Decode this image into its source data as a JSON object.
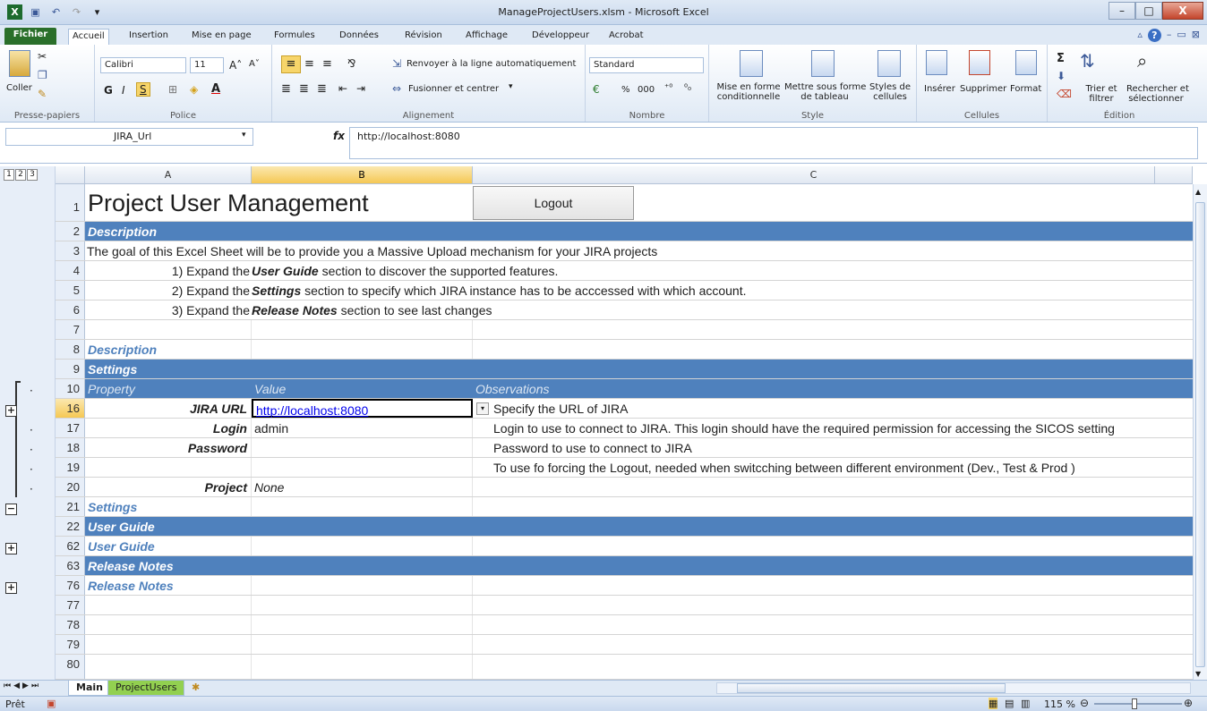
{
  "window": {
    "title": "ManageProjectUsers.xlsm - Microsoft Excel",
    "minimize": "–",
    "restore": "□",
    "close": "X"
  },
  "tabs": [
    "Fichier",
    "Accueil",
    "Insertion",
    "Mise en page",
    "Formules",
    "Données",
    "Révision",
    "Affichage",
    "Développeur",
    "Acrobat"
  ],
  "ribbon": {
    "paste_label": "Coller",
    "font_name": "Calibri",
    "font_size": "11",
    "bold": "G",
    "italic": "I",
    "underline": "S",
    "wrap_text": "Renvoyer à la ligne automatiquement",
    "merge_center": "Fusionner et centrer",
    "number_format": "Standard",
    "percent": "%",
    "thousands": "000",
    "cond_format_1": "Mise en forme",
    "cond_format_2": "conditionnelle",
    "format_table_1": "Mettre sous forme",
    "format_table_2": "de tableau",
    "cell_styles_1": "Styles de",
    "cell_styles_2": "cellules",
    "insert": "Insérer",
    "delete": "Supprimer",
    "format": "Format",
    "sort_1": "Trier et",
    "sort_2": "filtrer",
    "find_1": "Rechercher et",
    "find_2": "sélectionner",
    "groups": [
      "Presse-papiers",
      "Police",
      "Alignement",
      "Nombre",
      "Style",
      "Cellules",
      "Édition"
    ]
  },
  "formula_bar": {
    "name_box": "JIRA_Url",
    "fx": "fx",
    "value": "http://localhost:8080"
  },
  "outline_levels": [
    "1",
    "2",
    "3"
  ],
  "columns": [
    "A",
    "B",
    "C"
  ],
  "rows": [
    {
      "num": "1",
      "a": "Project User Management",
      "b": "Logout",
      "c": ""
    },
    {
      "num": "2",
      "a": "Description",
      "b": "",
      "c": ""
    },
    {
      "num": "3",
      "a": "The goal of this Excel Sheet will be to provide you a Massive Upload mechanism for your JIRA projects",
      "b": "",
      "c": ""
    },
    {
      "num": "4",
      "a": "1) Expand the ",
      "a_em": "User Guide",
      "a_tail": "  section to discover the supported features."
    },
    {
      "num": "5",
      "a": "2) Expand the ",
      "a_em": "Settings",
      "a_tail": "  section to specify which JIRA instance has to be acccessed with which account."
    },
    {
      "num": "6",
      "a": "3) Expand the ",
      "a_em": "Release Notes",
      "a_tail": "  section to see last changes"
    },
    {
      "num": "7",
      "a": "",
      "b": "",
      "c": ""
    },
    {
      "num": "8",
      "a": "Description",
      "b": "",
      "c": ""
    },
    {
      "num": "9",
      "a": "Settings",
      "b": "",
      "c": ""
    },
    {
      "num": "10",
      "a": "Property",
      "b": "Value",
      "c": "Observations"
    },
    {
      "num": "16",
      "a": "JIRA URL",
      "b": "http://localhost:8080",
      "c": "Specify the URL of JIRA"
    },
    {
      "num": "17",
      "a": "Login",
      "b": "admin",
      "c": "Login to use  to connect to JIRA. This login should have the required permission for accessing the SICOS setting"
    },
    {
      "num": "18",
      "a": "Password",
      "b": "",
      "c": "Password to use to connect to JIRA"
    },
    {
      "num": "19",
      "a": "",
      "b": "",
      "c": "To use fo forcing the Logout, needed when switcching between different environment (Dev., Test & Prod )"
    },
    {
      "num": "20",
      "a": "Project",
      "b": "None",
      "c": ""
    },
    {
      "num": "21",
      "a": "Settings",
      "b": "",
      "c": ""
    },
    {
      "num": "22",
      "a": "User Guide",
      "b": "",
      "c": ""
    },
    {
      "num": "62",
      "a": "User Guide",
      "b": "",
      "c": ""
    },
    {
      "num": "63",
      "a": "Release Notes",
      "b": "",
      "c": ""
    },
    {
      "num": "76",
      "a": "Release Notes",
      "b": "",
      "c": ""
    },
    {
      "num": "77",
      "a": "",
      "b": "",
      "c": ""
    },
    {
      "num": "78",
      "a": "",
      "b": "",
      "c": ""
    },
    {
      "num": "79",
      "a": "",
      "b": "",
      "c": ""
    },
    {
      "num": "80",
      "a": "",
      "b": "",
      "c": ""
    }
  ],
  "sheet_tabs": [
    "Main",
    "ProjectUsers"
  ],
  "status": {
    "ready": "Prêt",
    "zoom": "115 %"
  },
  "colors": {
    "band": "#4f81bd",
    "file_tab": "#2a6f2a",
    "selection": "#f5c854"
  }
}
